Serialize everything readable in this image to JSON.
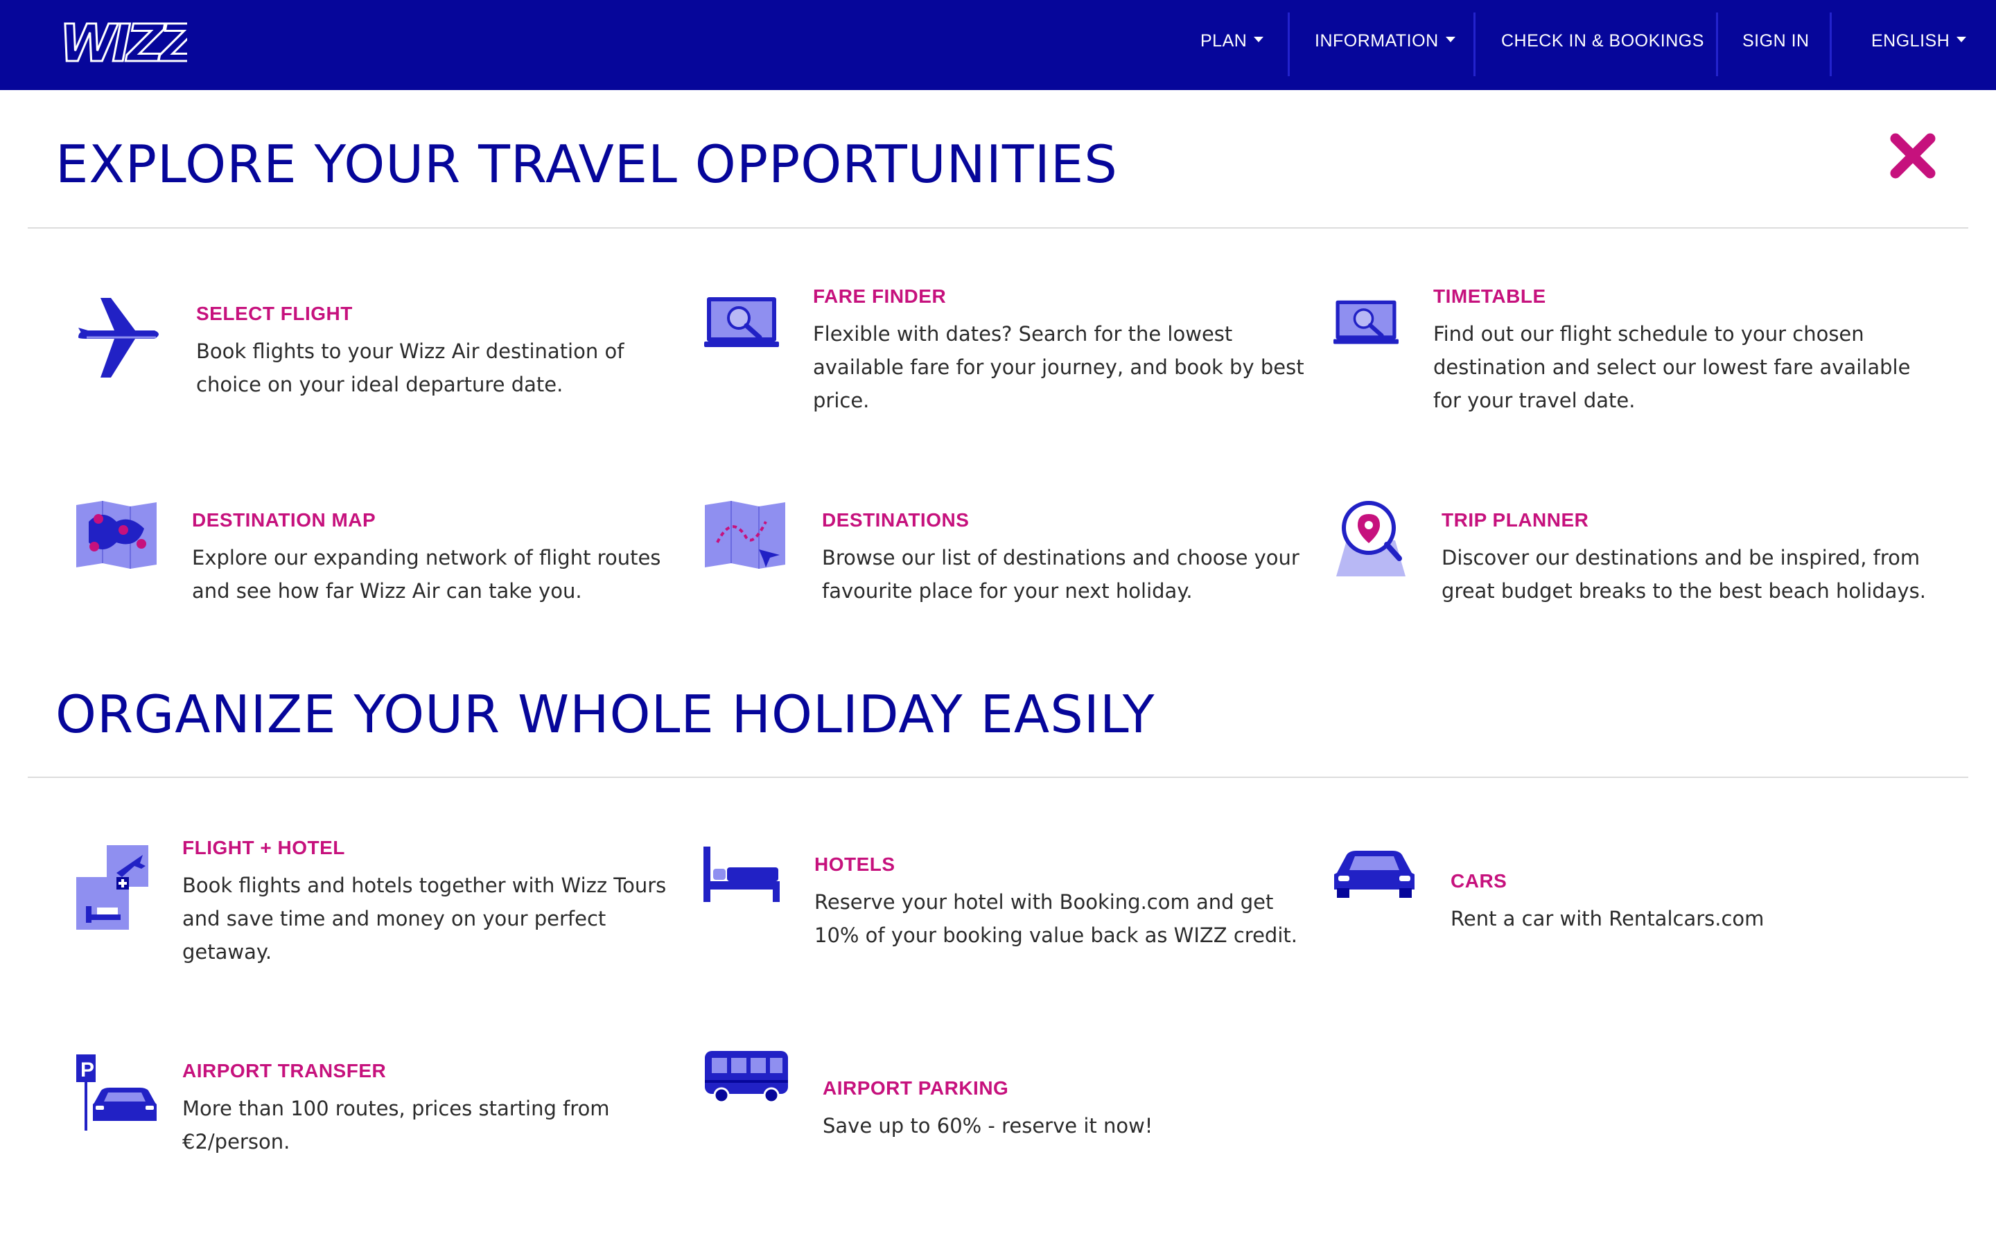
{
  "nav": {
    "logo": "WIZZ",
    "plan": "PLAN",
    "information": "INFORMATION",
    "checkin": "CHECK IN & BOOKINGS",
    "signin": "SIGN IN",
    "language": "ENGLISH"
  },
  "explore": {
    "title": "EXPLORE YOUR TRAVEL OPPORTUNITIES",
    "items": [
      {
        "icon": "airplane-icon",
        "title": "SELECT FLIGHT",
        "desc": "Book flights to your Wizz Air destination of choice on your ideal departure date."
      },
      {
        "icon": "laptop-search-icon",
        "title": "FARE FINDER",
        "desc": "Flexible with dates? Search for the lowest available fare for your journey, and book by best price."
      },
      {
        "icon": "laptop-search-icon",
        "title": "TIMETABLE",
        "desc": "Find out our flight schedule to your chosen destination and select our lowest fare available for your travel date."
      },
      {
        "icon": "map-pins-icon",
        "title": "DESTINATION MAP",
        "desc": "Explore our expanding network of flight routes and see how far Wizz Air can take you."
      },
      {
        "icon": "map-route-icon",
        "title": "DESTINATIONS",
        "desc": "Browse our list of destinations and choose your favourite place for your next holiday."
      },
      {
        "icon": "location-search-icon",
        "title": "TRIP PLANNER",
        "desc": "Discover our destinations and be inspired, from great budget breaks to the best beach holidays."
      }
    ]
  },
  "organize": {
    "title": "ORGANIZE YOUR WHOLE HOLIDAY EASILY",
    "items": [
      {
        "icon": "flight-hotel-icon",
        "title": "FLIGHT + HOTEL",
        "desc": "Book flights and hotels together with Wizz Tours and save time and money on your perfect getaway."
      },
      {
        "icon": "bed-icon",
        "title": "HOTELS",
        "desc": "Reserve your hotel with Booking.com and get 10% of your booking value back as WIZZ credit."
      },
      {
        "icon": "car-icon",
        "title": "CARS",
        "desc": "Rent a car with Rentalcars.com"
      },
      {
        "icon": "parking-car-icon",
        "title": "AIRPORT TRANSFER",
        "desc": "More than 100 routes, prices starting from €2/person."
      },
      {
        "icon": "bus-icon",
        "title": "AIRPORT PARKING",
        "desc": "Save up to 60% - reserve it now!"
      }
    ]
  },
  "colors": {
    "brand": "#06069a",
    "accent": "#c6117d",
    "icon_blue": "#2121c5",
    "icon_light": "#8f8ff0"
  }
}
